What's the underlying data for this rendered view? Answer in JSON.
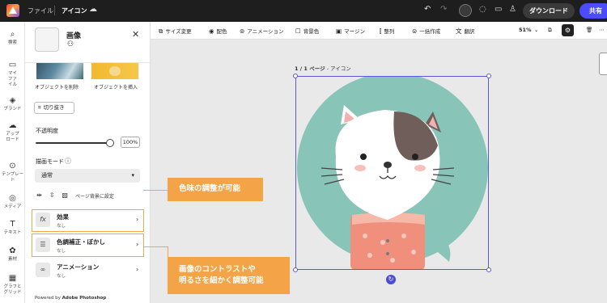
{
  "topbar": {
    "file_label": "ファイル",
    "doc_title": "アイコン",
    "download_label": "ダウンロード",
    "share_label": "共有"
  },
  "rail": {
    "items": [
      {
        "label": "検索",
        "icon": "search-icon"
      },
      {
        "label": "マイファイル",
        "icon": "folder-icon"
      },
      {
        "label": "ブランド",
        "icon": "brand-icon"
      },
      {
        "label": "アップロード",
        "icon": "upload-icon"
      },
      {
        "label": "テンプレート",
        "icon": "template-icon"
      },
      {
        "label": "メディア",
        "icon": "media-icon"
      },
      {
        "label": "テキスト",
        "icon": "text-icon"
      },
      {
        "label": "素材",
        "icon": "elements-icon"
      },
      {
        "label": "グラフとグリッド",
        "icon": "grid-icon"
      }
    ]
  },
  "panel": {
    "title": "画像",
    "remove_object_label": "オブジェクトを削除",
    "insert_object_label": "オブジェクトを挿入",
    "crop_label": "切り抜き",
    "opacity_label": "不透明度",
    "opacity_value": "100%",
    "opacity_level": 1.0,
    "blend_mode_label": "描画モード",
    "blend_mode_value": "通常",
    "set_background_label": "ページ背景に設定",
    "items": [
      {
        "title": "効果",
        "sub": "なし",
        "icon": "fx-icon"
      },
      {
        "title": "色調補正・ぼかし",
        "sub": "なし",
        "icon": "adjust-icon"
      },
      {
        "title": "アニメーション",
        "sub": "なし",
        "icon": "animation-icon"
      }
    ],
    "footer_prefix": "Powered by",
    "footer_brand": "Adobe Photoshop"
  },
  "toolbar": {
    "resize_label": "サイズ変更",
    "color_label": "配色",
    "animation_label": "アニメーション",
    "bg_color_label": "背景色",
    "margin_label": "マージン",
    "align_label": "整列",
    "bulk_create_label": "一括作成",
    "translate_label": "翻訳",
    "zoom": "51%"
  },
  "canvas": {
    "page_number": "1 / 1 ページ",
    "page_name": "アイコン",
    "colors": {
      "circle": "#88c4b8",
      "shirt": "#ef8f7c",
      "patch": "#6f5e59"
    }
  },
  "callouts": {
    "hue": "色味の調整が可能",
    "contrast_line1": "画像のコントラストや",
    "contrast_line2": "明るさを細かく調整可能"
  },
  "colors": {
    "accent": "#f5a347",
    "primary": "#4b4bff",
    "selection": "#5b5bd6"
  }
}
